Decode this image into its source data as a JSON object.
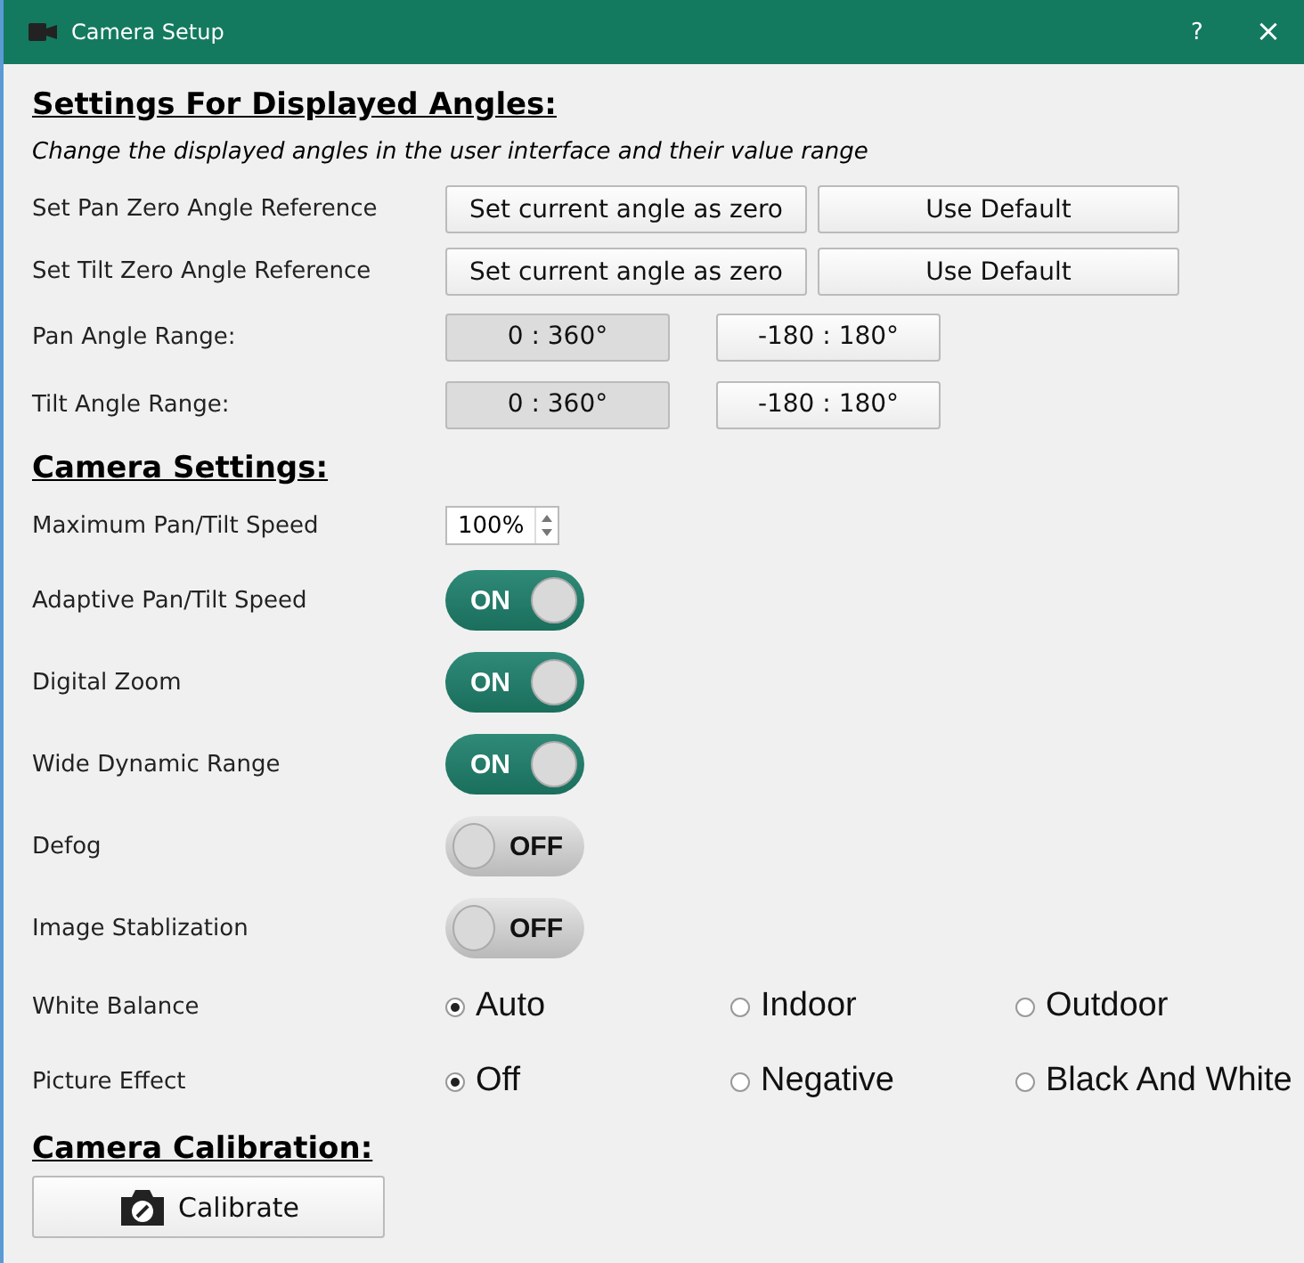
{
  "window": {
    "title": "Camera Setup",
    "help": "?",
    "close": "×"
  },
  "angles": {
    "heading": "Settings For Displayed Angles:",
    "description": "Change the displayed angles in the user interface and their value range",
    "zero_rows": [
      {
        "label": "Set Pan Zero Angle Reference",
        "buttons": [
          "Set current angle as zero",
          "Use Default"
        ]
      },
      {
        "label": "Set Tilt Zero Angle Reference",
        "buttons": [
          "Set current angle as zero",
          "Use Default"
        ]
      }
    ],
    "range_rows": [
      {
        "label": "Pan Angle Range:",
        "options": [
          {
            "label": "0 : 360°",
            "selected": true
          },
          {
            "label": "-180 : 180°",
            "selected": false
          }
        ]
      },
      {
        "label": "Tilt Angle Range:",
        "options": [
          {
            "label": "0 : 360°",
            "selected": true
          },
          {
            "label": "-180 : 180°",
            "selected": false
          }
        ]
      }
    ]
  },
  "camera": {
    "heading": "Camera Settings:",
    "settings": [
      {
        "kind": "spinbox",
        "label": "Maximum Pan/Tilt Speed",
        "value": "100%"
      },
      {
        "kind": "toggle",
        "label": "Adaptive Pan/Tilt Speed",
        "on": true,
        "text": "ON"
      },
      {
        "kind": "toggle",
        "label": "Digital Zoom",
        "on": true,
        "text": "ON"
      },
      {
        "kind": "toggle",
        "label": "Wide Dynamic Range",
        "on": true,
        "text": "ON"
      },
      {
        "kind": "toggle",
        "label": "Defog",
        "on": false,
        "text": "OFF"
      },
      {
        "kind": "toggle",
        "label": "Image Stablization",
        "on": false,
        "text": "OFF"
      },
      {
        "kind": "radio",
        "label": "White Balance",
        "options": [
          {
            "label": "Auto",
            "selected": true
          },
          {
            "label": "Indoor",
            "selected": false
          },
          {
            "label": "Outdoor",
            "selected": false
          }
        ]
      },
      {
        "kind": "radio",
        "label": "Picture Effect",
        "options": [
          {
            "label": "Off",
            "selected": true
          },
          {
            "label": "Negative",
            "selected": false
          },
          {
            "label": "Black And White",
            "selected": false
          }
        ]
      }
    ]
  },
  "calibration": {
    "heading": "Camera Calibration:",
    "button": "Calibrate"
  }
}
